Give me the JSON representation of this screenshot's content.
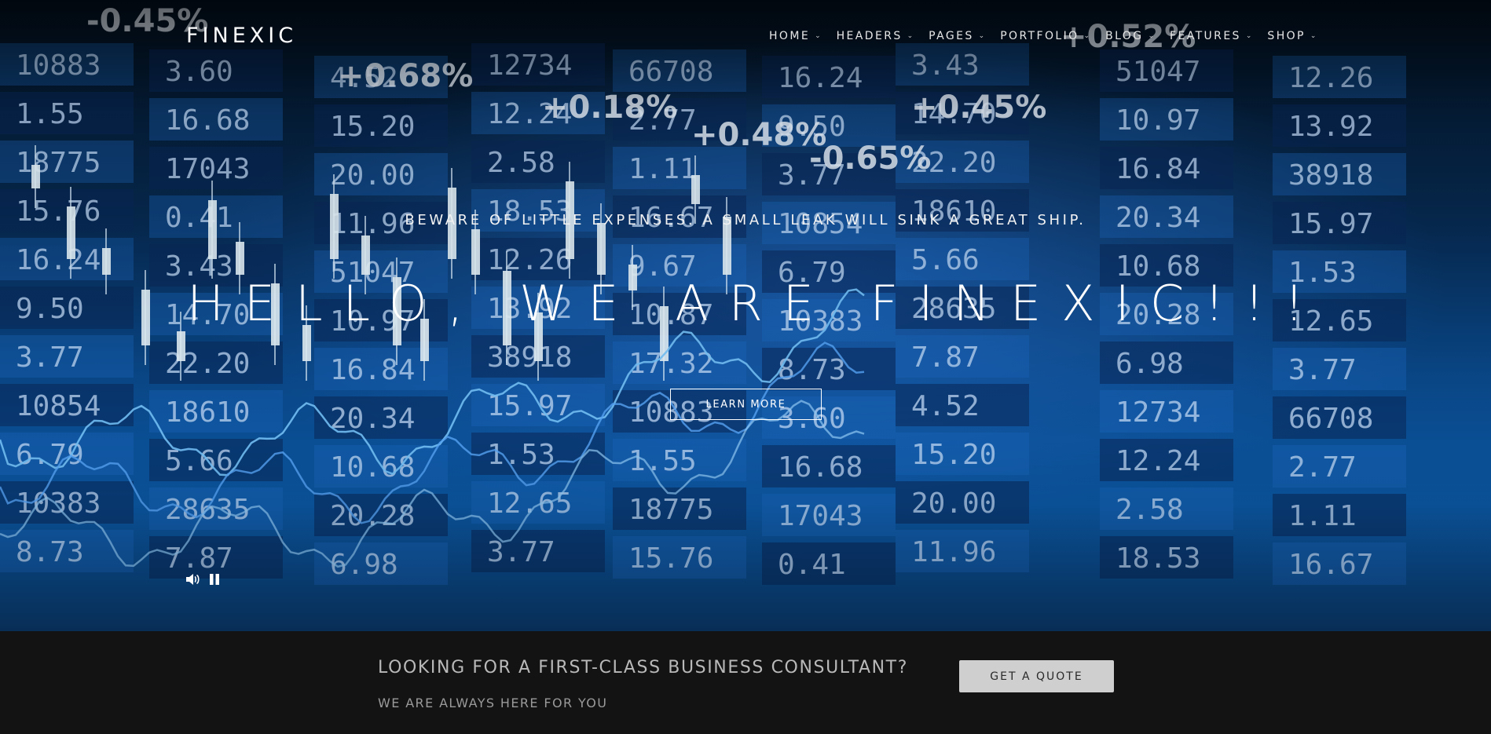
{
  "brand": {
    "logo": "FINEXIC"
  },
  "nav": {
    "items": [
      {
        "label": "HOME"
      },
      {
        "label": "HEADERS"
      },
      {
        "label": "PAGES"
      },
      {
        "label": "PORTFOLIO"
      },
      {
        "label": "BLOG"
      },
      {
        "label": "FEATURES"
      },
      {
        "label": "SHOP"
      }
    ],
    "chevron": "⌄"
  },
  "hero": {
    "tagline": "BEWARE OF LITTLE EXPENSES. A SMALL LEAK WILL SINK A GREAT SHIP.",
    "headline": "HELLO, WE ARE FINEXIC!!!",
    "button_label": "LEARN MORE",
    "background_tiles": [
      "10883",
      "1.55",
      "18775",
      "15.76",
      "16.24",
      "9.50",
      "3.77",
      "10854",
      "6.79",
      "10383",
      "8.73",
      "3.60",
      "16.68",
      "17043",
      "0.41",
      "3.43",
      "14.70",
      "22.20",
      "18610",
      "5.66",
      "28635",
      "7.87",
      "4.52",
      "15.20",
      "20.00",
      "11.96",
      "51047",
      "10.97",
      "16.84",
      "20.34",
      "10.68",
      "20.28",
      "6.98",
      "12734",
      "12.24",
      "2.58",
      "18.53",
      "12.26",
      "13.92",
      "38918",
      "15.97",
      "1.53",
      "12.65",
      "3.77",
      "66708",
      "2.77",
      "1.11",
      "16.67",
      "9.67",
      "10.87",
      "17.32"
    ],
    "percent_tiles": [
      "-0.45%",
      "+0.68%",
      "+0.18%",
      "+0.48%",
      "-0.65%",
      "+0.45%",
      "+0.52%"
    ],
    "icons": {
      "volume": "volume-icon",
      "pause": "pause-icon"
    }
  },
  "cta": {
    "title": "LOOKING FOR A FIRST-CLASS BUSINESS CONSULTANT?",
    "subtitle": "WE ARE ALWAYS HERE FOR YOU",
    "button_label": "GET A QUOTE"
  },
  "colors": {
    "cta_background": "#131313",
    "quote_button": "#cfcfcf",
    "hero_accent": "#0b5aa8"
  }
}
